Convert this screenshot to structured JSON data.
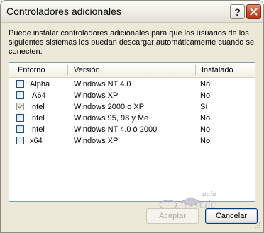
{
  "window": {
    "title": "Controladores adicionales",
    "help_symbol": "?"
  },
  "description": {
    "line1": "Puede instalar controladores adicionales para que los usuarios de los",
    "line2": "siguientes sistemas los puedan descargar automáticamente cuando se",
    "line3": "conecten."
  },
  "list": {
    "columns": {
      "environment": "Entorno",
      "version": "Versión",
      "installed": "Instalado"
    },
    "rows": [
      {
        "environment": "Alpha",
        "version": "Windows NT 4.0",
        "installed": "No",
        "checked": false
      },
      {
        "environment": "IA64",
        "version": "Windows XP",
        "installed": "No",
        "checked": false
      },
      {
        "environment": "Intel",
        "version": "Windows 2000 o XP",
        "installed": "Sí",
        "checked": true
      },
      {
        "environment": "Intel",
        "version": "Windows 95, 98 y Me",
        "installed": "No",
        "checked": false
      },
      {
        "environment": "Intel",
        "version": "Windows NT 4.0 ó 2000",
        "installed": "No",
        "checked": false
      },
      {
        "environment": "x64",
        "version": "Windows XP",
        "installed": "No",
        "checked": false
      }
    ]
  },
  "buttons": {
    "ok": "Aceptar",
    "cancel": "Cancelar"
  },
  "watermark": {
    "text": "aula clic"
  },
  "colors": {
    "dialog_bg": "#ece9d8",
    "list_border": "#7f9db9",
    "close_button": "#c8482a",
    "default_button_border": "#003c74"
  }
}
